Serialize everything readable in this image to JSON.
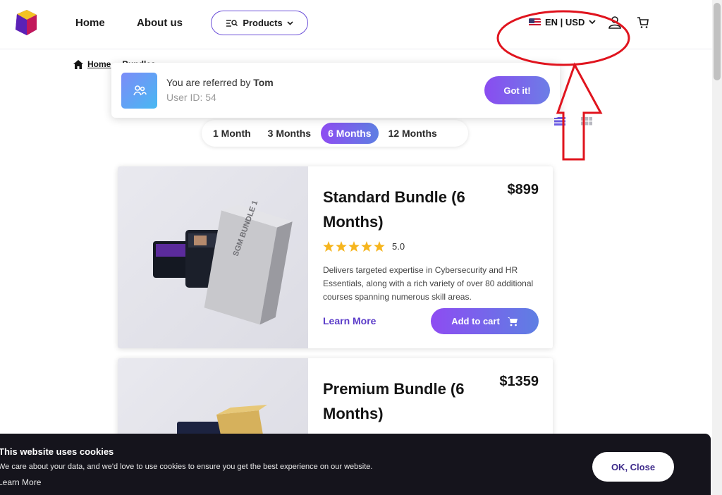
{
  "header": {
    "nav": {
      "home": "Home",
      "about": "About us"
    },
    "products_label": "Products",
    "locale": "EN | USD"
  },
  "breadcrumb": {
    "home": "Home",
    "current": "Bundles"
  },
  "referral": {
    "prefix": "You are referred by ",
    "referrer": "Tom",
    "user_id_label": "User ID: ",
    "user_id": "54",
    "button": "Got it!"
  },
  "tabs": [
    {
      "label": "1 Month",
      "active": false
    },
    {
      "label": "3 Months",
      "active": false
    },
    {
      "label": "6 Months",
      "active": true
    },
    {
      "label": "12 Months",
      "active": false
    }
  ],
  "products": [
    {
      "title": "Standard Bundle (6 Months)",
      "price": "$899",
      "rating": "5.0",
      "stars": 5,
      "box_label": "SGM BUNDLE 1",
      "description": "Delivers targeted expertise in Cybersecurity and HR Essentials, along with a rich variety of over 80 additional courses spanning numerous skill areas.",
      "learn_more": "Learn More",
      "add_to_cart": "Add to cart"
    },
    {
      "title": "Premium Bundle (6 Months)",
      "price": "$1359"
    }
  ],
  "cookie": {
    "title": "This website uses cookies",
    "text": "We care about your data, and we'd love to use cookies to ensure you get the best experience on our website.",
    "learn_more": "Learn More",
    "button": "OK, Close"
  },
  "colors": {
    "accent_start": "#8e4cf2",
    "accent_end": "#5e7fe3",
    "annotation": "#e0141e",
    "star": "#f6b51e"
  }
}
